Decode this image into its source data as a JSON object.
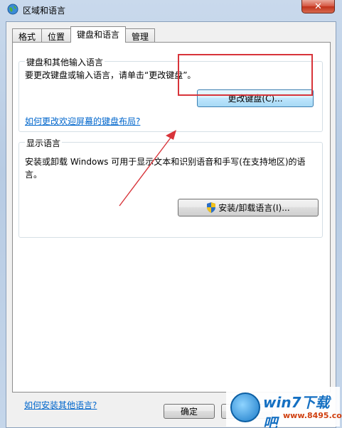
{
  "window": {
    "title": "区域和语言",
    "close_label": "✕"
  },
  "tabs": [
    {
      "label": "格式"
    },
    {
      "label": "位置"
    },
    {
      "label": "键盘和语言"
    },
    {
      "label": "管理"
    }
  ],
  "keyboard_group": {
    "legend": "键盘和其他输入语言",
    "description": "要更改键盘或输入语言，请单击“更改键盘”。",
    "change_button": "更改键盘(C)...",
    "welcome_link": "如何更改欢迎屏幕的键盘布局?"
  },
  "display_group": {
    "legend": "显示语言",
    "description_line1": "安装或卸载 Windows 可用于显示文本和识别语音和手写(在支持地区)的语",
    "description_line2": "言。",
    "install_button": "安装/卸载语言(I)..."
  },
  "footer": {
    "install_link": "如何安装其他语言?",
    "ok_button": "确定"
  },
  "watermark": {
    "brand": "win7下载吧",
    "url": "www.8495.com"
  },
  "colors": {
    "link": "#0066cc",
    "highlight_box": "#d8343a",
    "arrow": "#d8343a"
  }
}
